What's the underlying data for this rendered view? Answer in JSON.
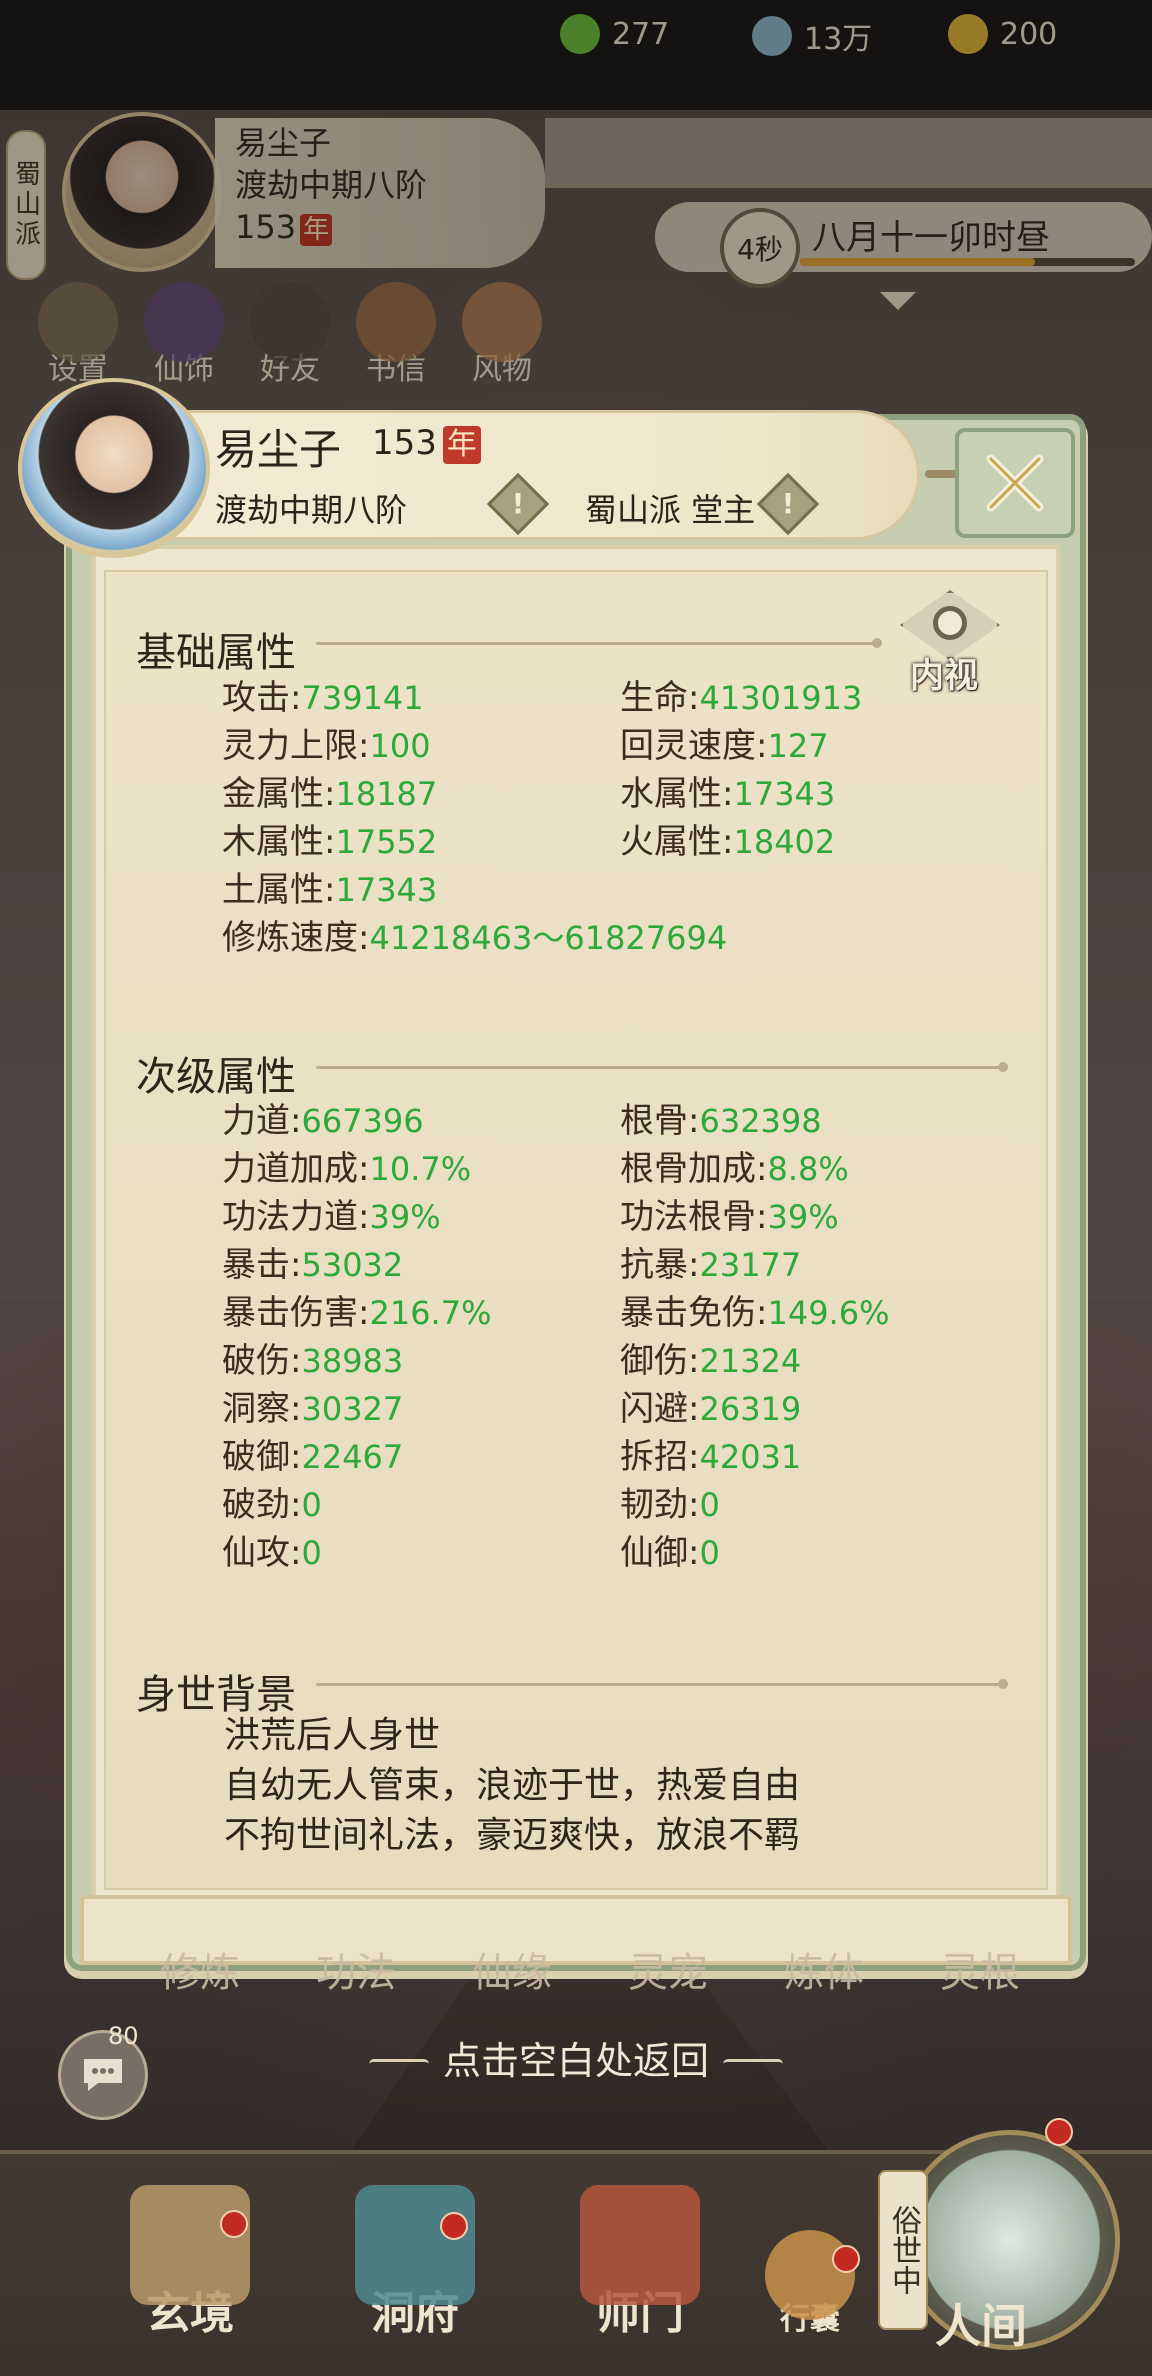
{
  "hud": {
    "sect_tag": "蜀山派",
    "name": "易尘子",
    "realm": "渡劫中期八阶",
    "age": "153",
    "age_unit": "年",
    "currency": [
      {
        "icon": "leaf-icon",
        "value": "277",
        "color": "#6fbf3f"
      },
      {
        "icon": "coin-icon",
        "value": "13万",
        "color": "#8fb6c8"
      },
      {
        "icon": "ingot-icon",
        "value": "200",
        "color": "#e0b43a"
      }
    ],
    "timer_seconds": "4秒",
    "time_label": "八月十一卯时昼",
    "time_progress": 0.7,
    "menu": [
      {
        "label": "设置",
        "icon": "gear-icon"
      },
      {
        "label": "仙饰",
        "icon": "ornament-icon"
      },
      {
        "label": "好友",
        "icon": "friends-icon"
      },
      {
        "label": "书信",
        "icon": "letter-icon"
      },
      {
        "label": "风物",
        "icon": "cards-icon"
      }
    ]
  },
  "panel": {
    "name": "易尘子",
    "age": "153",
    "age_unit": "年",
    "realm": "渡劫中期八阶",
    "sect": "蜀山派 堂主",
    "info_mark": "!",
    "inner_view_label": "内视",
    "basic": {
      "title": "基础属性",
      "stats": [
        {
          "label": "攻击:",
          "value": "739141"
        },
        {
          "label": "生命:",
          "value": "41301913"
        },
        {
          "label": "灵力上限:",
          "value": "100"
        },
        {
          "label": "回灵速度:",
          "value": "127"
        },
        {
          "label": "金属性:",
          "value": "18187"
        },
        {
          "label": "水属性:",
          "value": "17343"
        },
        {
          "label": "木属性:",
          "value": "17552"
        },
        {
          "label": "火属性:",
          "value": "18402"
        },
        {
          "label": "土属性:",
          "value": "17343"
        },
        {
          "label": "修炼速度:",
          "value": "41218463～61827694"
        }
      ]
    },
    "secondary": {
      "title": "次级属性",
      "stats": [
        {
          "label": "力道:",
          "value": "667396"
        },
        {
          "label": "根骨:",
          "value": "632398"
        },
        {
          "label": "力道加成:",
          "value": "10.7%"
        },
        {
          "label": "根骨加成:",
          "value": "8.8%"
        },
        {
          "label": "功法力道:",
          "value": "39%"
        },
        {
          "label": "功法根骨:",
          "value": "39%"
        },
        {
          "label": "暴击:",
          "value": "53032"
        },
        {
          "label": "抗暴:",
          "value": "23177"
        },
        {
          "label": "暴击伤害:",
          "value": "216.7%"
        },
        {
          "label": "暴击免伤:",
          "value": "149.6%"
        },
        {
          "label": "破伤:",
          "value": "38983"
        },
        {
          "label": "御伤:",
          "value": "21324"
        },
        {
          "label": "洞察:",
          "value": "30327"
        },
        {
          "label": "闪避:",
          "value": "26319"
        },
        {
          "label": "破御:",
          "value": "22467"
        },
        {
          "label": "拆招:",
          "value": "42031"
        },
        {
          "label": "破劲:",
          "value": "0"
        },
        {
          "label": "韧劲:",
          "value": "0"
        },
        {
          "label": "仙攻:",
          "value": "0"
        },
        {
          "label": "仙御:",
          "value": "0"
        }
      ]
    },
    "background": {
      "title": "身世背景",
      "lines": [
        "洪荒后人身世",
        "自幼无人管束，浪迹于世，热爱自由",
        "不拘世间礼法，豪迈爽快，放浪不羁"
      ]
    }
  },
  "behind_tabs": [
    "修炼",
    "功法",
    "仙缘",
    "灵宠",
    "炼体",
    "灵根"
  ],
  "chat_badge": "80",
  "return_hint": "点击空白处返回",
  "bottom_nav": [
    {
      "label": "玄境",
      "icon": "scroll-icon"
    },
    {
      "label": "洞府",
      "icon": "pavilion-icon"
    },
    {
      "label": "师门",
      "icon": "banner-icon"
    },
    {
      "label": "行囊",
      "icon": "bag-icon"
    }
  ],
  "world": {
    "side_label": "俗世中",
    "label": "人间"
  },
  "colors": {
    "stat_value": "#2da83a",
    "accent_red": "#c0392b",
    "frame_green": "#8fa07e"
  }
}
